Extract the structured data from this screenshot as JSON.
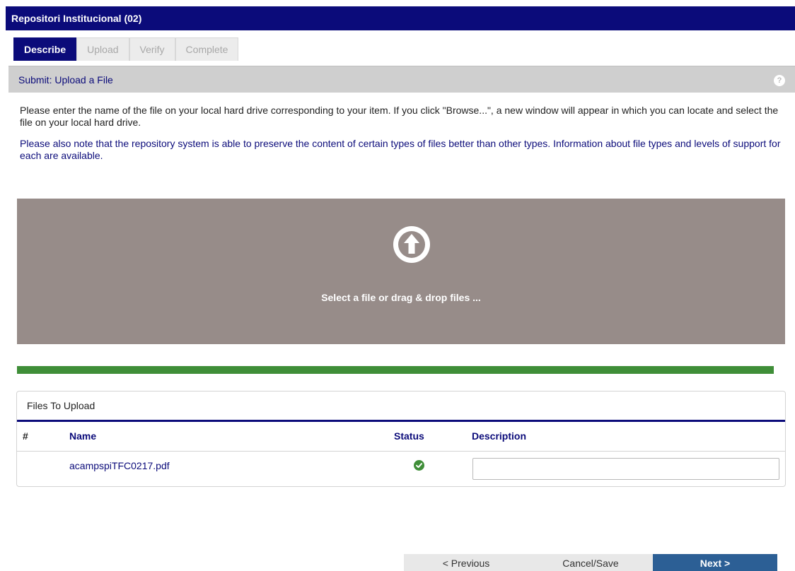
{
  "header": {
    "title": "Repositori Institucional (02)"
  },
  "steps": [
    {
      "label": "Describe"
    },
    {
      "label": "Upload"
    },
    {
      "label": "Verify"
    },
    {
      "label": "Complete"
    }
  ],
  "panel": {
    "title": "Submit: Upload a File",
    "help": "?"
  },
  "intro_text": "Please enter the name of the file on your local hard drive corresponding to your item. If you click \"Browse...\", a new window will appear in which you can locate and select the file on your local hard drive.",
  "note_text": "Please also note that the repository system is able to preserve the content of certain types of files better than other types. Information about file types and levels of support for each are available.",
  "dropzone": {
    "text": "Select a file or drag & drop files ...",
    "icon": "upload-arrow-icon"
  },
  "progress": {
    "percent": 100,
    "color": "#3f8e38"
  },
  "files_table": {
    "title": "Files To Upload",
    "columns": {
      "index": "#",
      "name": "Name",
      "status": "Status",
      "description": "Description"
    },
    "rows": [
      {
        "index": "",
        "name": "acampspiTFC0217.pdf",
        "status": "success",
        "description": ""
      }
    ]
  },
  "buttons": {
    "previous": "< Previous",
    "cancel": "Cancel/Save",
    "next": "Next >"
  },
  "colors": {
    "brand": "#0b0b7a",
    "dropzone": "#978c89",
    "success": "#3f8e38",
    "next_button": "#2c5f95"
  }
}
